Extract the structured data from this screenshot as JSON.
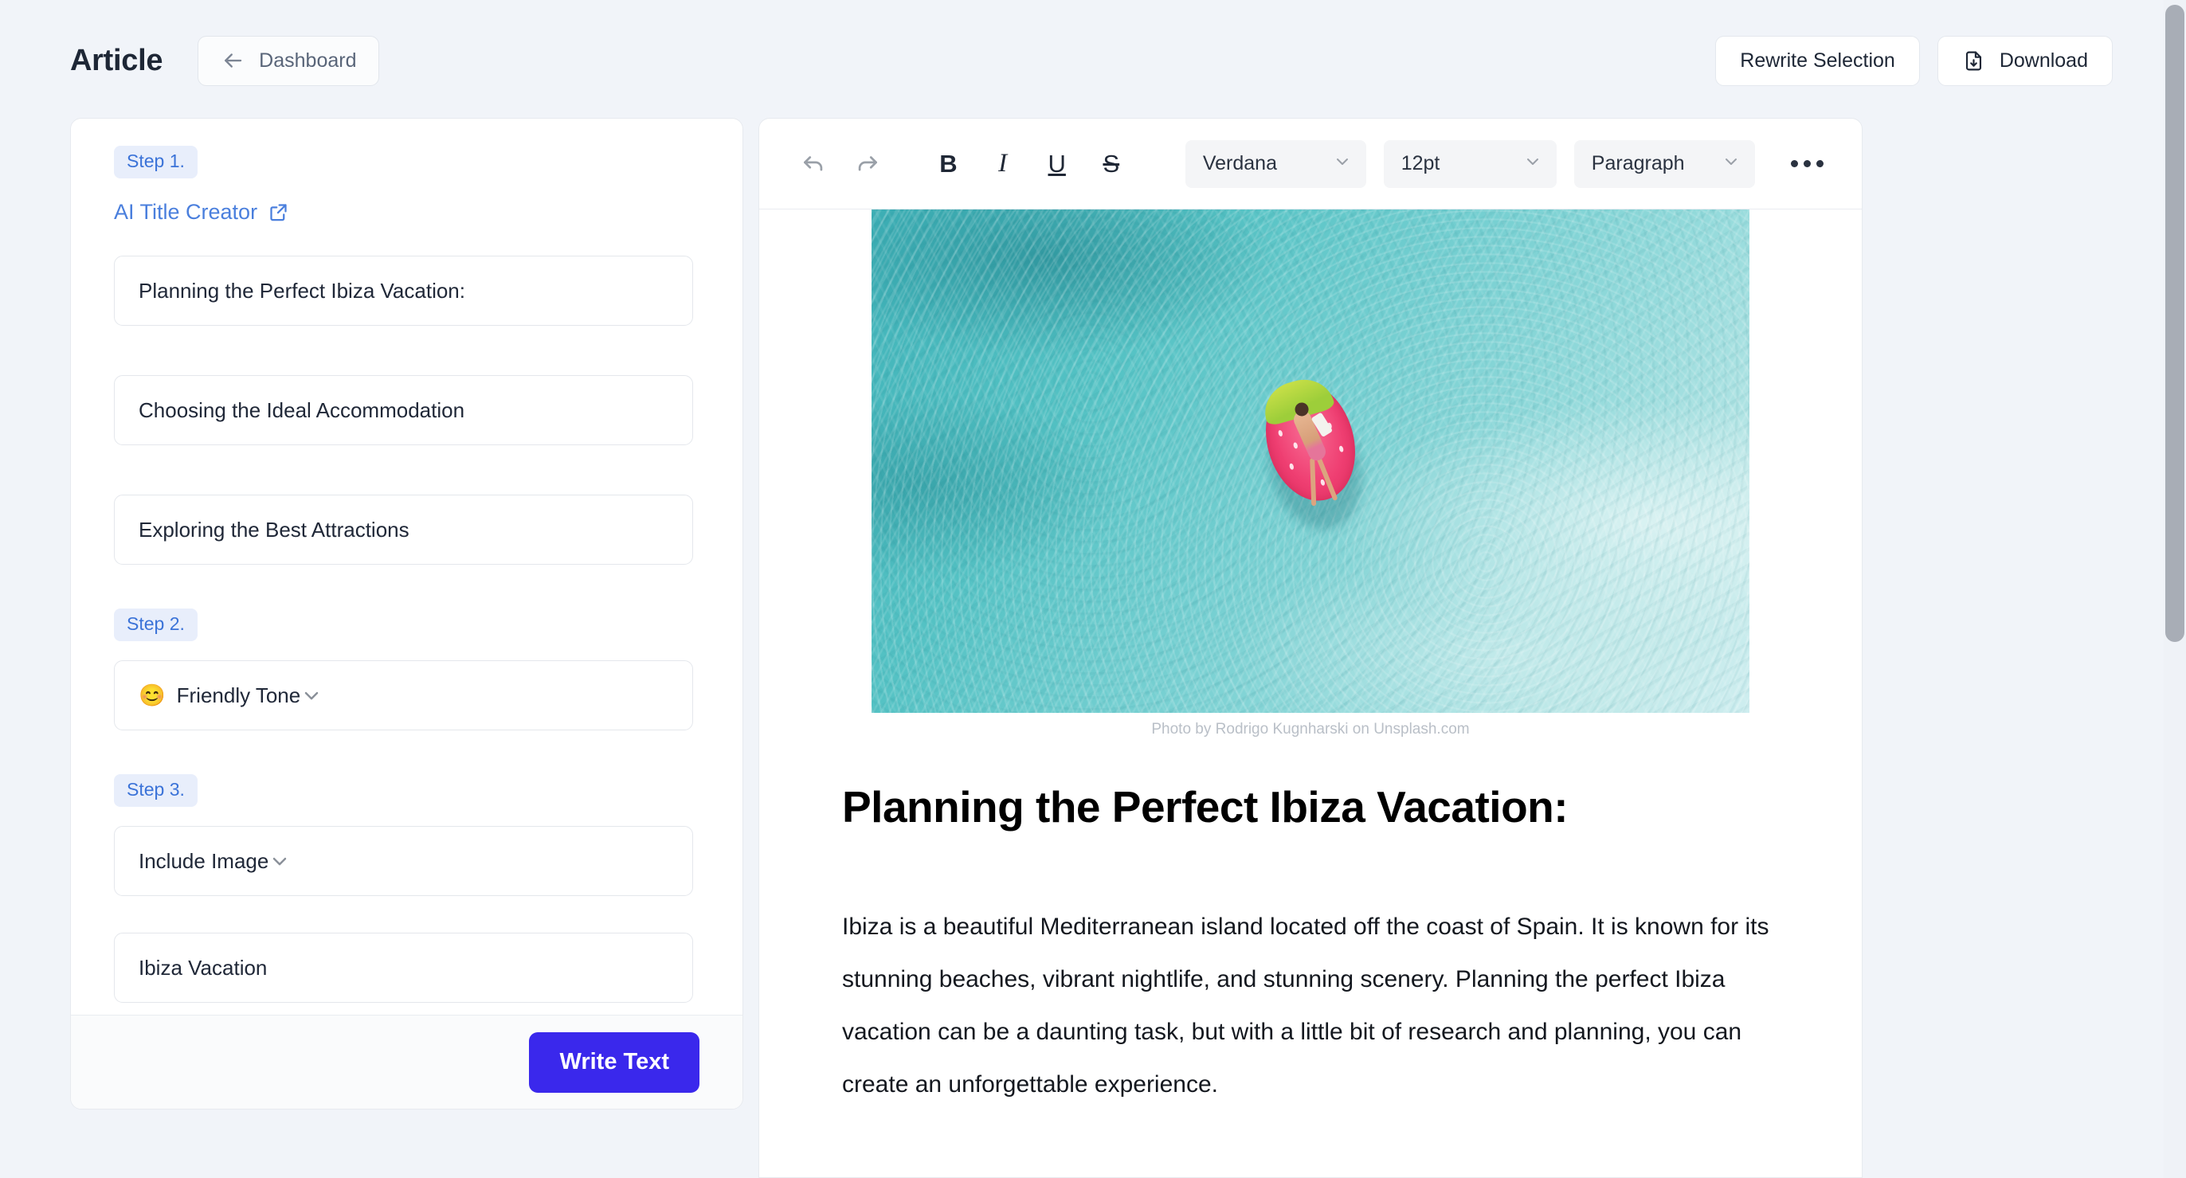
{
  "header": {
    "title": "Article",
    "dashboard_label": "Dashboard",
    "back_icon": "arrow-left-icon",
    "rewrite_label": "Rewrite Selection",
    "download_label": "Download",
    "download_icon": "document-download-icon"
  },
  "sidebar": {
    "step1": {
      "badge": "Step 1.",
      "link_label": "AI Title Creator",
      "link_icon": "external-link-icon",
      "titles": [
        "Planning the Perfect Ibiza Vacation:",
        "Choosing the Ideal Accommodation",
        "Exploring the Best Attractions"
      ]
    },
    "step2": {
      "badge": "Step 2.",
      "tone_emoji": "😊",
      "tone_value": "Friendly Tone",
      "chevron_icon": "chevron-down-icon"
    },
    "step3": {
      "badge": "Step 3.",
      "image_option_value": "Include Image",
      "keyword_value": "Ibiza Vacation",
      "chevron_icon": "chevron-down-icon"
    },
    "footer": {
      "write_label": "Write Text",
      "write_color": "#3a28ec"
    }
  },
  "editor": {
    "toolbar": {
      "undo_icon": "undo-icon",
      "redo_icon": "redo-icon",
      "bold_label": "B",
      "italic_label": "I",
      "underline_label": "U",
      "strike_label": "S",
      "font_family_value": "Verdana",
      "font_size_value": "12pt",
      "block_format_value": "Paragraph",
      "more_icon": "ellipsis-icon",
      "chevron_icon": "chevron-down-icon"
    },
    "document": {
      "hero_image_alt": "aerial photo of a person floating on a pink watermelon ring in turquoise ocean water",
      "photo_credit": "Photo by Rodrigo Kugnharski on Unsplash.com",
      "heading": "Planning the Perfect Ibiza Vacation:",
      "paragraph": "Ibiza is a beautiful Mediterranean island located off the coast of Spain. It is known for its stunning beaches, vibrant nightlife, and stunning scenery. Planning the perfect Ibiza vacation can be a daunting task, but with a little bit of research and planning, you can create an unforgettable experience."
    }
  },
  "colors": {
    "page_background": "#f1f4f9",
    "accent_blue": "#4a7fdd",
    "badge_background": "#e8eefb",
    "primary_button": "#3a28ec",
    "scrollbar_thumb": "#a8adb6"
  }
}
